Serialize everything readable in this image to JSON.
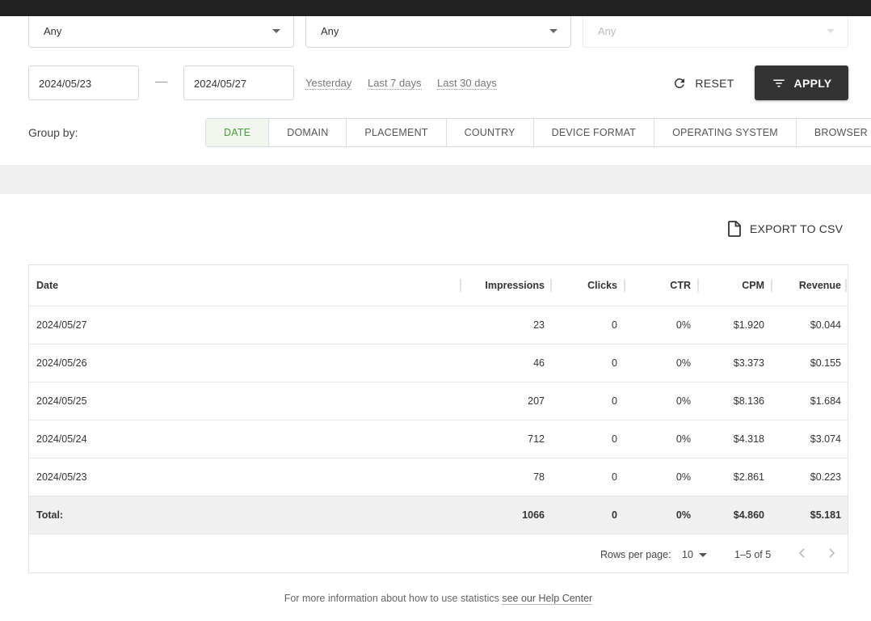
{
  "filters": {
    "select1": "Any",
    "select2": "Any",
    "select3": "Any",
    "date_from": "2024/05/23",
    "date_to": "2024/05/27",
    "quick_ranges": [
      "Yesterday",
      "Last 7 days",
      "Last 30 days"
    ],
    "reset_label": "RESET",
    "apply_label": "APPLY"
  },
  "group_by": {
    "label": "Group by:",
    "tabs": [
      "DATE",
      "DOMAIN",
      "PLACEMENT",
      "COUNTRY",
      "DEVICE FORMAT",
      "OPERATING SYSTEM",
      "BROWSER"
    ],
    "active": "DATE"
  },
  "export_label": "EXPORT TO CSV",
  "table": {
    "columns": [
      "Date",
      "Impressions",
      "Clicks",
      "CTR",
      "CPM",
      "Revenue"
    ],
    "rows": [
      [
        "2024/05/27",
        "23",
        "0",
        "0%",
        "$1.920",
        "$0.044"
      ],
      [
        "2024/05/26",
        "46",
        "0",
        "0%",
        "$3.373",
        "$0.155"
      ],
      [
        "2024/05/25",
        "207",
        "0",
        "0%",
        "$8.136",
        "$1.684"
      ],
      [
        "2024/05/24",
        "712",
        "0",
        "0%",
        "$4.318",
        "$3.074"
      ],
      [
        "2024/05/23",
        "78",
        "0",
        "0%",
        "$2.861",
        "$0.223"
      ]
    ],
    "total": [
      "Total:",
      "1066",
      "0",
      "0%",
      "$4.860",
      "$5.181"
    ]
  },
  "pagination": {
    "rows_per_page_label": "Rows per page:",
    "rows_per_page": "10",
    "range": "1–5 of 5"
  },
  "help": {
    "text": "For more information about how to use statistics ",
    "link": "see our Help Center"
  },
  "colors": {
    "accent_green": "#4a9a3e",
    "apply_bg": "#333333",
    "topbar": "#212121"
  }
}
